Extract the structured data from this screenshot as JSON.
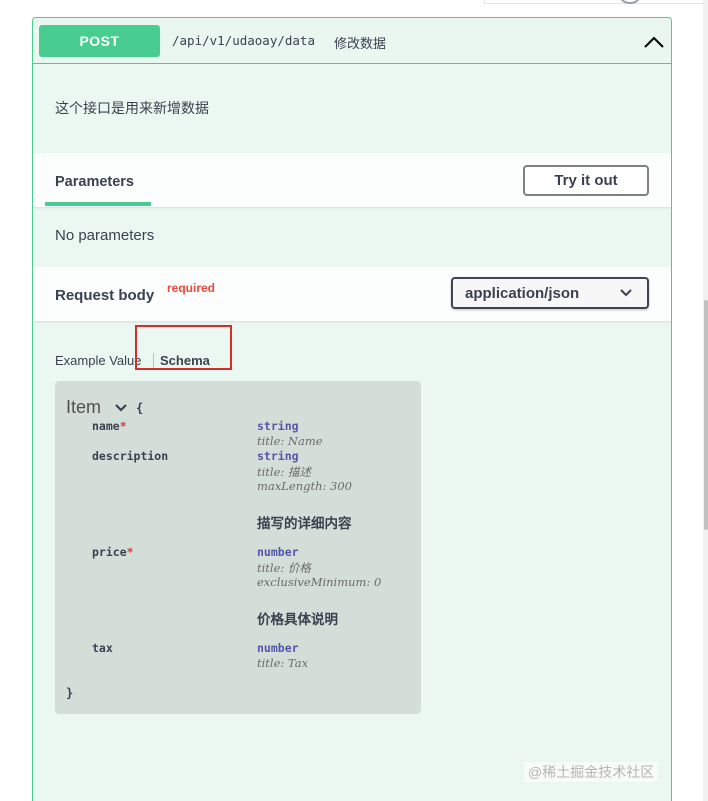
{
  "operation": {
    "method": "POST",
    "path": "/api/v1/udaoay/data",
    "summary": "修改数据",
    "description": "这个接口是用来新增数据"
  },
  "parameters": {
    "tab_label": "Parameters",
    "try_button": "Try it out",
    "empty_text": "No parameters"
  },
  "request_body": {
    "title": "Request body",
    "required_label": "required",
    "content_type": "application/json"
  },
  "model_tabs": {
    "example": "Example Value",
    "schema": "Schema"
  },
  "model": {
    "name": "Item",
    "open_brace": "{",
    "close_brace": "}",
    "properties": [
      {
        "name": "name",
        "required": "*",
        "type": "string",
        "meta": [
          "title: Name"
        ],
        "desc": ""
      },
      {
        "name": "description",
        "required": "",
        "type": "string",
        "meta": [
          "title: 描述",
          "maxLength: 300"
        ],
        "desc": "描写的详细内容"
      },
      {
        "name": "price",
        "required": "*",
        "type": "number",
        "meta": [
          "title: 价格",
          "exclusiveMinimum: 0"
        ],
        "desc": "价格具体说明"
      },
      {
        "name": "tax",
        "required": "",
        "type": "number",
        "meta": [
          "title: Tax"
        ],
        "desc": ""
      }
    ]
  },
  "watermark": "@稀土掘金技术社区",
  "colors": {
    "post_green": "#49cc90",
    "block_bg": "#ebf8f1",
    "required_red": "#e74c3c",
    "type_color": "#55a",
    "highlight_red": "#d62c2c"
  }
}
